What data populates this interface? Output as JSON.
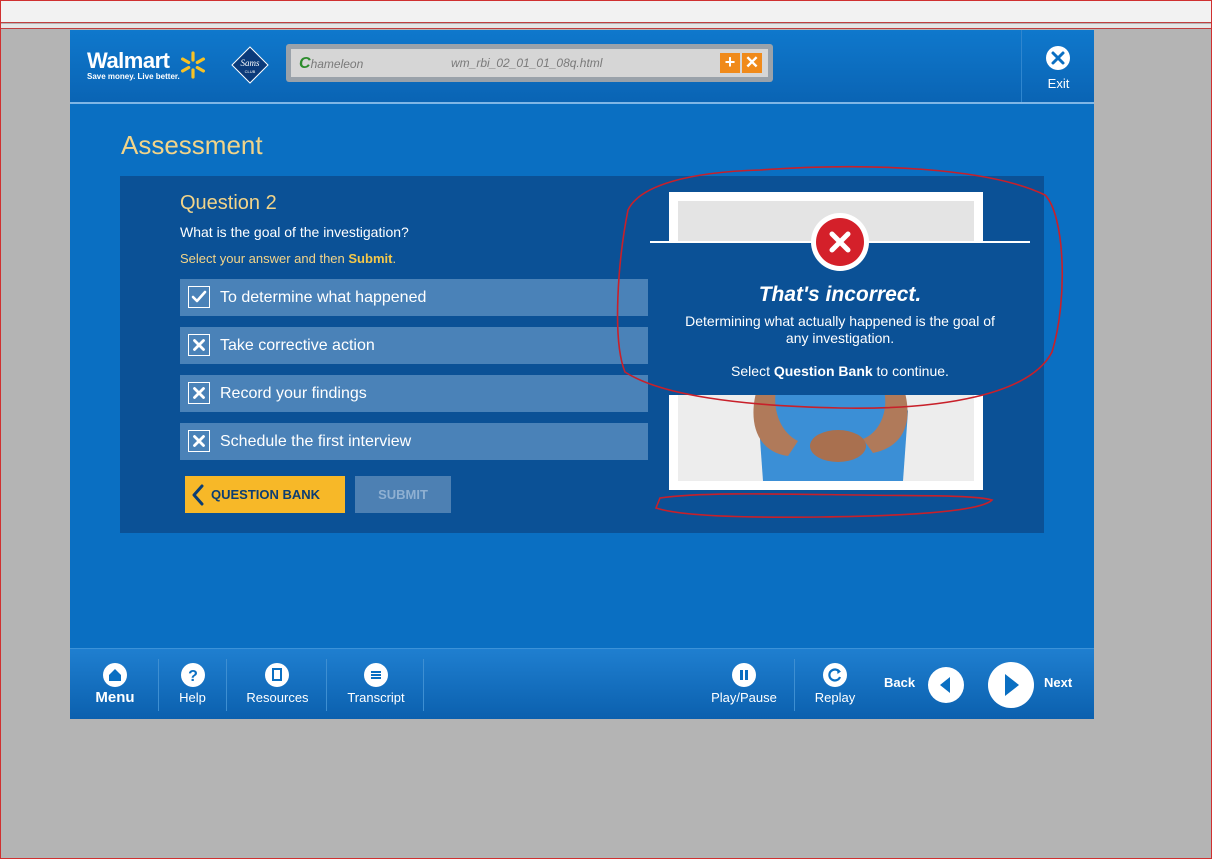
{
  "header": {
    "brand_name": "Walmart",
    "brand_tagline": "Save money. Live better.",
    "partner_logo_text": "Sams",
    "partner_logo_sub": "CLUB",
    "viewer_logo": "hameleon",
    "viewer_logo_c": "C",
    "viewer_file": "wm_rbi_02_01_01_08q.html",
    "exit_label": "Exit"
  },
  "page": {
    "title": "Assessment"
  },
  "question": {
    "title": "Question 2",
    "text": "What is the goal of the investigation?",
    "instruction_prefix": "Select your answer and then ",
    "instruction_action": "Submit",
    "instruction_suffix": ".",
    "options": [
      {
        "label": "To determine what happened",
        "state": "correct"
      },
      {
        "label": "Take corrective action",
        "state": "wrong"
      },
      {
        "label": "Record your findings",
        "state": "wrong"
      },
      {
        "label": "Schedule the first interview",
        "state": "wrong"
      }
    ],
    "question_bank_label": "QUESTION BANK",
    "submit_label": "SUBMIT"
  },
  "feedback": {
    "title": "That's incorrect.",
    "body": "Determining what actually happened is the goal of any investigation.",
    "continue_prefix": "Select ",
    "continue_bold": "Question Bank",
    "continue_suffix": " to continue."
  },
  "footer": {
    "menu": "Menu",
    "help": "Help",
    "resources": "Resources",
    "transcript": "Transcript",
    "play_pause": "Play/Pause",
    "replay": "Replay",
    "back": "Back",
    "next": "Next"
  },
  "colors": {
    "app_blue": "#0a6fc2",
    "panel_blue": "#0b5196",
    "gold": "#f2d489",
    "button_yellow": "#f7b828",
    "error_red": "#d4202a",
    "annotation_red": "#c8202a"
  }
}
